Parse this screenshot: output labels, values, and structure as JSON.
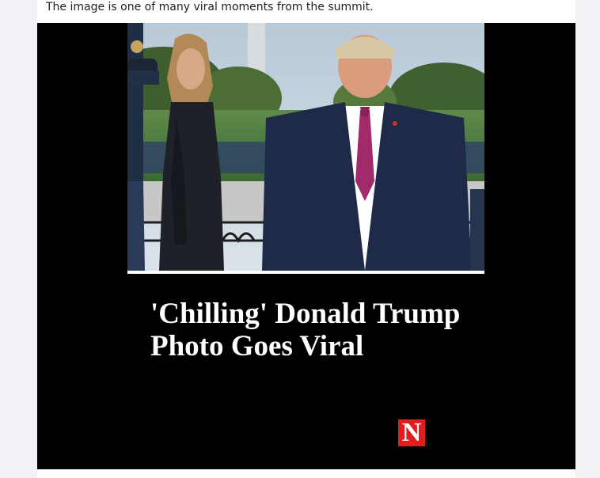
{
  "post": {
    "caption": "The image is one of many viral moments from the summit."
  },
  "media": {
    "headline": "'Chilling' Donald Trump Photo Goes Viral",
    "logo_text": "N",
    "photo_subject": "man in dark suit with magenta tie and woman in dark coat standing on a balcony, obelisk and crowd in background",
    "colors": {
      "background": "#000000",
      "headline": "#ffffff",
      "logo": "#e01e1e",
      "tie": "#a12a6a",
      "suit": "#1e2a47"
    }
  }
}
